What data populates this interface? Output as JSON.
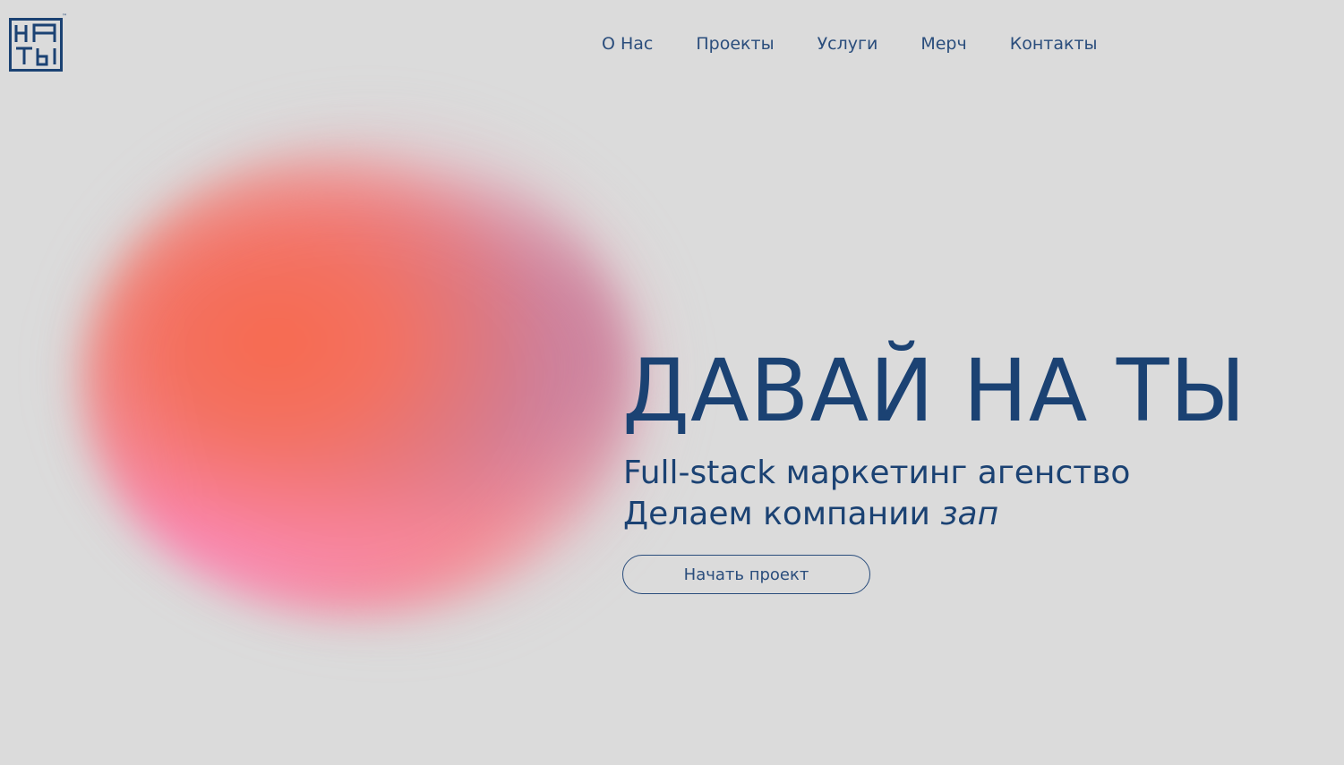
{
  "logo": {
    "line1": "НА",
    "line2": "ТЫ",
    "trademark": "™"
  },
  "nav": {
    "items": [
      {
        "label": "О Нас"
      },
      {
        "label": "Проекты"
      },
      {
        "label": "Услуги"
      },
      {
        "label": "Мерч"
      },
      {
        "label": "Контакты"
      }
    ]
  },
  "hero": {
    "title": "ДАВАЙ НА ТЫ",
    "subtitle_line1": "Full-stack маркетинг агенство",
    "subtitle_line2_prefix": "Делаем компании",
    "subtitle_line2_accent": "зап",
    "cta_label": "Начать проект"
  },
  "colors": {
    "background": "#dbdbdb",
    "brand_text": "#1b4273",
    "blob_orange": "#f76a4f",
    "blob_pink": "#fa86b4",
    "blob_mauve": "#c97e9b"
  },
  "icons": {
    "logo": "logo-mark-icon"
  }
}
